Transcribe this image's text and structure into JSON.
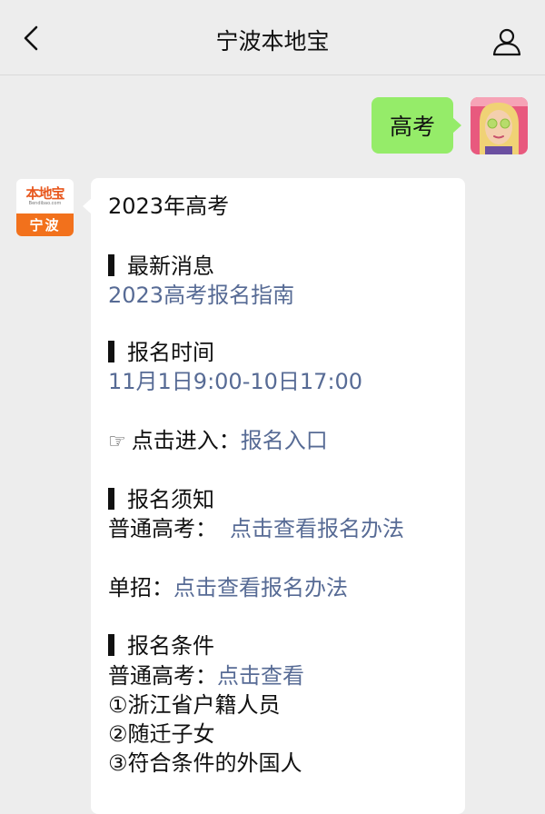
{
  "header": {
    "title": "宁波本地宝"
  },
  "chat": {
    "user_message": "高考",
    "bot_avatar": {
      "logo_text": "本地宝",
      "logo_sub": "Bendibao.com",
      "city": "宁波"
    },
    "bot_message": {
      "heading": "2023年高考",
      "s1_title": "最新消息",
      "s1_link": "2023高考报名指南",
      "s2_title": "报名时间",
      "s2_value": "11月1日9:00-10日17:00",
      "enter_icon": "☞",
      "enter_label": "点击进入：",
      "enter_link": "报名入口",
      "s3_title": "报名须知",
      "ordinary_label": "普通高考：",
      "ordinary_link": "点击查看报名办法",
      "single_label": "单招：",
      "single_link": "点击查看报名办法",
      "s4_title": "报名条件",
      "cond_label": "普通高考：",
      "cond_link": "点击查看",
      "cond_1": "①浙江省户籍人员",
      "cond_2": "②随迁子女",
      "cond_3": "③符合条件的外国人"
    }
  },
  "icons": {
    "back": "chevron-left-icon",
    "profile": "person-icon"
  },
  "colors": {
    "background": "#ededed",
    "user_bubble": "#95ec69",
    "link": "#576b95",
    "brand_orange": "#f2711c"
  }
}
